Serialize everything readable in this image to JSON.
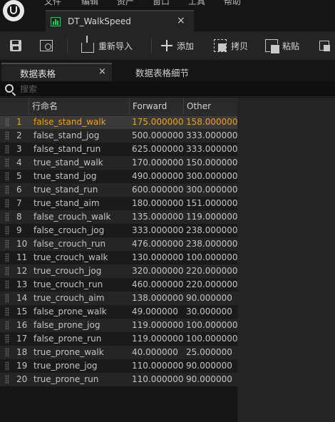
{
  "menu": {
    "items": [
      "文件",
      "编辑",
      "资产",
      "窗口",
      "工具",
      "帮助"
    ]
  },
  "document_tab": {
    "title": "DT_WalkSpeed",
    "close_glyph": "×"
  },
  "toolbar": {
    "reimport_label": "重新导入",
    "add_label": "添加",
    "copy_label": "拷贝",
    "paste_label": "粘贴"
  },
  "panel_tabs": {
    "data_table": "数据表格",
    "close_glyph": "×",
    "row_editor": "数据表格细节"
  },
  "search": {
    "placeholder": "搜索"
  },
  "table": {
    "columns": [
      "",
      "行命名",
      "Forward",
      "Other"
    ],
    "selected_row": 1,
    "selected_color": "#f0a30a",
    "rows": [
      {
        "num": "1",
        "name": "false_stand_walk",
        "forward": "175.000000",
        "other": "158.000000"
      },
      {
        "num": "2",
        "name": "false_stand_jog",
        "forward": "500.000000",
        "other": "333.000000"
      },
      {
        "num": "3",
        "name": "false_stand_run",
        "forward": "625.000000",
        "other": "333.000000"
      },
      {
        "num": "4",
        "name": "true_stand_walk",
        "forward": "170.000000",
        "other": "150.000000"
      },
      {
        "num": "5",
        "name": "true_stand_jog",
        "forward": "490.000000",
        "other": "300.000000"
      },
      {
        "num": "6",
        "name": "true_stand_run",
        "forward": "600.000000",
        "other": "300.000000"
      },
      {
        "num": "7",
        "name": "true_stand_aim",
        "forward": "180.000000",
        "other": "151.000000"
      },
      {
        "num": "8",
        "name": "false_crouch_walk",
        "forward": "135.000000",
        "other": "119.000000"
      },
      {
        "num": "9",
        "name": "false_crouch_jog",
        "forward": "333.000000",
        "other": "238.000000"
      },
      {
        "num": "10",
        "name": "false_crouch_run",
        "forward": "476.000000",
        "other": "238.000000"
      },
      {
        "num": "11",
        "name": "true_crouch_walk",
        "forward": "130.000000",
        "other": "100.000000"
      },
      {
        "num": "12",
        "name": "true_crouch_jog",
        "forward": "320.000000",
        "other": "220.000000"
      },
      {
        "num": "13",
        "name": "true_crouch_run",
        "forward": "460.000000",
        "other": "220.000000"
      },
      {
        "num": "14",
        "name": "true_crouch_aim",
        "forward": "138.000000",
        "other": "90.000000"
      },
      {
        "num": "15",
        "name": "false_prone_walk",
        "forward": "49.000000",
        "other": "30.000000"
      },
      {
        "num": "16",
        "name": "false_prone_jog",
        "forward": "119.000000",
        "other": "100.000000"
      },
      {
        "num": "17",
        "name": "false_prone_run",
        "forward": "119.000000",
        "other": "100.000000"
      },
      {
        "num": "18",
        "name": "true_prone_walk",
        "forward": "40.000000",
        "other": "25.000000"
      },
      {
        "num": "19",
        "name": "true_prone_jog",
        "forward": "110.000000",
        "other": "90.000000"
      },
      {
        "num": "20",
        "name": "true_prone_run",
        "forward": "110.000000",
        "other": "90.000000"
      }
    ]
  }
}
